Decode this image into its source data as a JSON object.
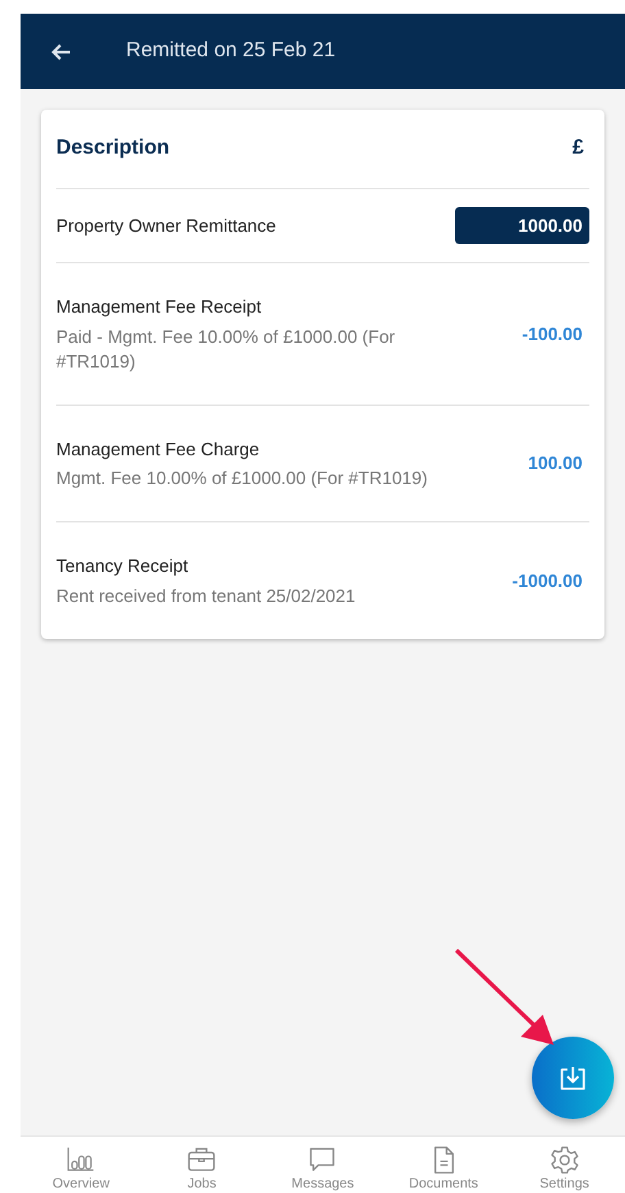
{
  "header": {
    "title": "Remitted on 25 Feb 21"
  },
  "table": {
    "columns": [
      "Description",
      "£"
    ],
    "rows": [
      {
        "title": "Property Owner Remittance",
        "amount": "1000.00",
        "highlighted": true
      },
      {
        "title": "Management Fee Receipt",
        "subtitle": "Paid - Mgmt. Fee 10.00% of £1000.00 (For #TR1019)",
        "amount": "-100.00",
        "highlighted": false
      },
      {
        "title": "Management Fee Charge",
        "subtitle": "Mgmt. Fee 10.00% of £1000.00 (For #TR1019)",
        "amount": "100.00",
        "highlighted": false
      },
      {
        "title": "Tenancy Receipt",
        "subtitle": "Rent received from tenant 25/02/2021",
        "amount": "-1000.00",
        "highlighted": false
      }
    ]
  },
  "bottom_nav": [
    {
      "kind": "overview",
      "label": "Overview"
    },
    {
      "kind": "jobs",
      "label": "Jobs"
    },
    {
      "kind": "messages",
      "label": "Messages"
    },
    {
      "kind": "documents",
      "label": "Documents"
    },
    {
      "kind": "settings",
      "label": "Settings"
    }
  ]
}
